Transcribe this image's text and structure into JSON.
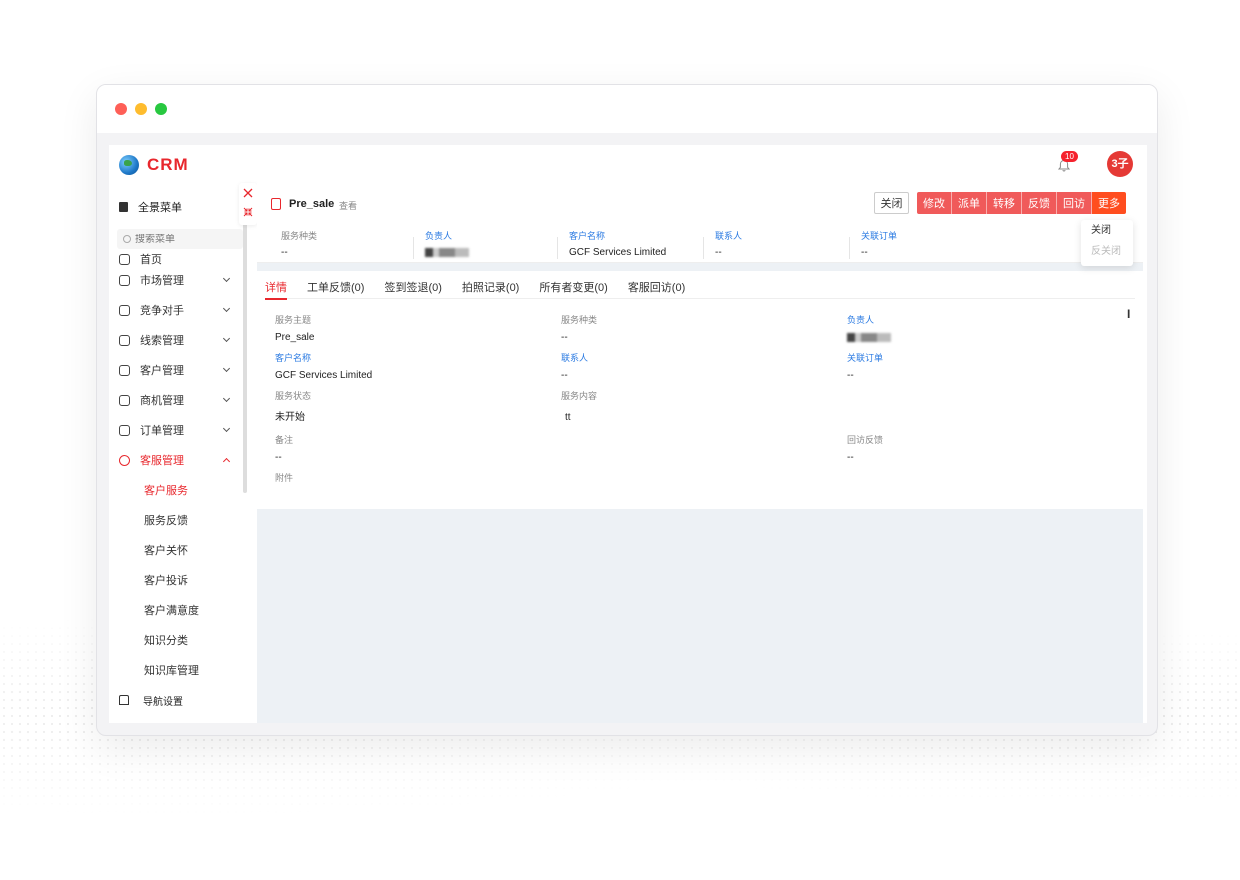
{
  "app": {
    "logo_text": "CRM",
    "notification_count": "10",
    "avatar_text": "3子"
  },
  "sidebar": {
    "all_menu_label": "全景菜单",
    "search_placeholder": "搜索菜单",
    "clipped_item_label": "首页",
    "items": [
      {
        "label": "市场管理",
        "icon": "market-icon"
      },
      {
        "label": "竞争对手",
        "icon": "competitor-icon"
      },
      {
        "label": "线索管理",
        "icon": "leads-icon"
      },
      {
        "label": "客户管理",
        "icon": "customer-icon"
      },
      {
        "label": "商机管理",
        "icon": "opportunity-icon"
      },
      {
        "label": "订单管理",
        "icon": "order-icon"
      },
      {
        "label": "客服管理",
        "icon": "headset-icon"
      }
    ],
    "sub_items": [
      {
        "label": "客户服务"
      },
      {
        "label": "服务反馈"
      },
      {
        "label": "客户关怀"
      },
      {
        "label": "客户投诉"
      },
      {
        "label": "客户满意度"
      },
      {
        "label": "知识分类"
      },
      {
        "label": "知识库管理"
      }
    ],
    "nav_settings_label": "导航设置"
  },
  "detail": {
    "title": "Pre_sale",
    "subtitle": "查看",
    "buttons": {
      "close": "关闭",
      "edit": "修改",
      "dispatch": "派单",
      "transfer": "转移",
      "feedback": "反馈",
      "revisit": "回访",
      "more": "更多"
    },
    "dropdown": {
      "close": "关闭",
      "reopen": "反关闭"
    },
    "meta": [
      {
        "label": "服务种类",
        "value": "--"
      },
      {
        "label": "负责人",
        "value": ""
      },
      {
        "label": "客户名称",
        "value": "GCF Services Limited"
      },
      {
        "label": "联系人",
        "value": "--"
      },
      {
        "label": "关联订单",
        "value": "--"
      }
    ],
    "tabs": [
      {
        "label": "详情"
      },
      {
        "label": "工单反馈(0)"
      },
      {
        "label": "签到签退(0)"
      },
      {
        "label": "拍照记录(0)"
      },
      {
        "label": "所有者变更(0)"
      },
      {
        "label": "客服回访(0)"
      }
    ],
    "fields": {
      "service_subject": {
        "label": "服务主题",
        "value": "Pre_sale"
      },
      "service_type": {
        "label": "服务种类",
        "value": "--"
      },
      "owner": {
        "label": "负责人",
        "value": ""
      },
      "customer_name": {
        "label": "客户名称",
        "value": "GCF Services Limited"
      },
      "contact": {
        "label": "联系人",
        "value": "--"
      },
      "related_order": {
        "label": "关联订单",
        "value": "--"
      },
      "service_status": {
        "label": "服务状态",
        "value": "未开始"
      },
      "service_content": {
        "label": "服务内容",
        "value": "tt"
      },
      "remark": {
        "label": "备注",
        "value": "--"
      },
      "revisit_feedback": {
        "label": "回访反馈",
        "value": "--"
      },
      "attachment": {
        "label": "附件"
      }
    }
  },
  "colors": {
    "accent": "#e8272d",
    "link": "#2a7ae2",
    "more_button": "#ff4d1f"
  }
}
